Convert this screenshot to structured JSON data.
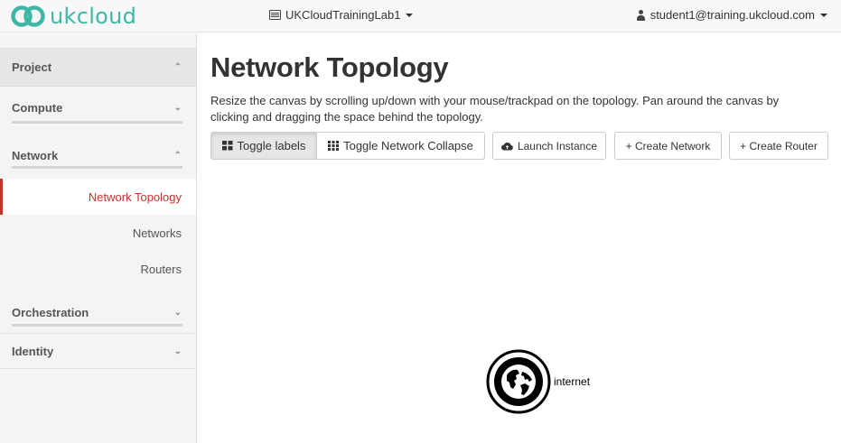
{
  "header": {
    "logo_text": "ukcloud",
    "project_name": "UKCloudTrainingLab1",
    "user": "student1@training.ukcloud.com"
  },
  "sidebar": {
    "sections": [
      {
        "label": "Project",
        "chevron": "^"
      },
      {
        "label": "Compute",
        "chevron": "v"
      },
      {
        "label": "Network",
        "chevron": "^"
      },
      {
        "label": "Orchestration",
        "chevron": "v"
      },
      {
        "label": "Identity",
        "chevron": "v"
      }
    ],
    "network_items": [
      {
        "label": "Network Topology",
        "active": true
      },
      {
        "label": "Networks"
      },
      {
        "label": "Routers"
      }
    ]
  },
  "main": {
    "title": "Network Topology",
    "description": "Resize the canvas by scrolling up/down with your mouse/trackpad on the topology. Pan around the canvas by clicking and dragging the space behind the topology.",
    "buttons": {
      "toggle_labels": "Toggle labels",
      "toggle_collapse": "Toggle Network Collapse",
      "launch_instance": "Launch Instance",
      "create_network": "+ Create Network",
      "create_router": "+ Create Router"
    }
  },
  "topology": {
    "nodes": [
      {
        "label": "internet",
        "icon": "globe-icon"
      }
    ]
  },
  "colors": {
    "brand": "#3fb7a5",
    "active": "#c9302c"
  }
}
